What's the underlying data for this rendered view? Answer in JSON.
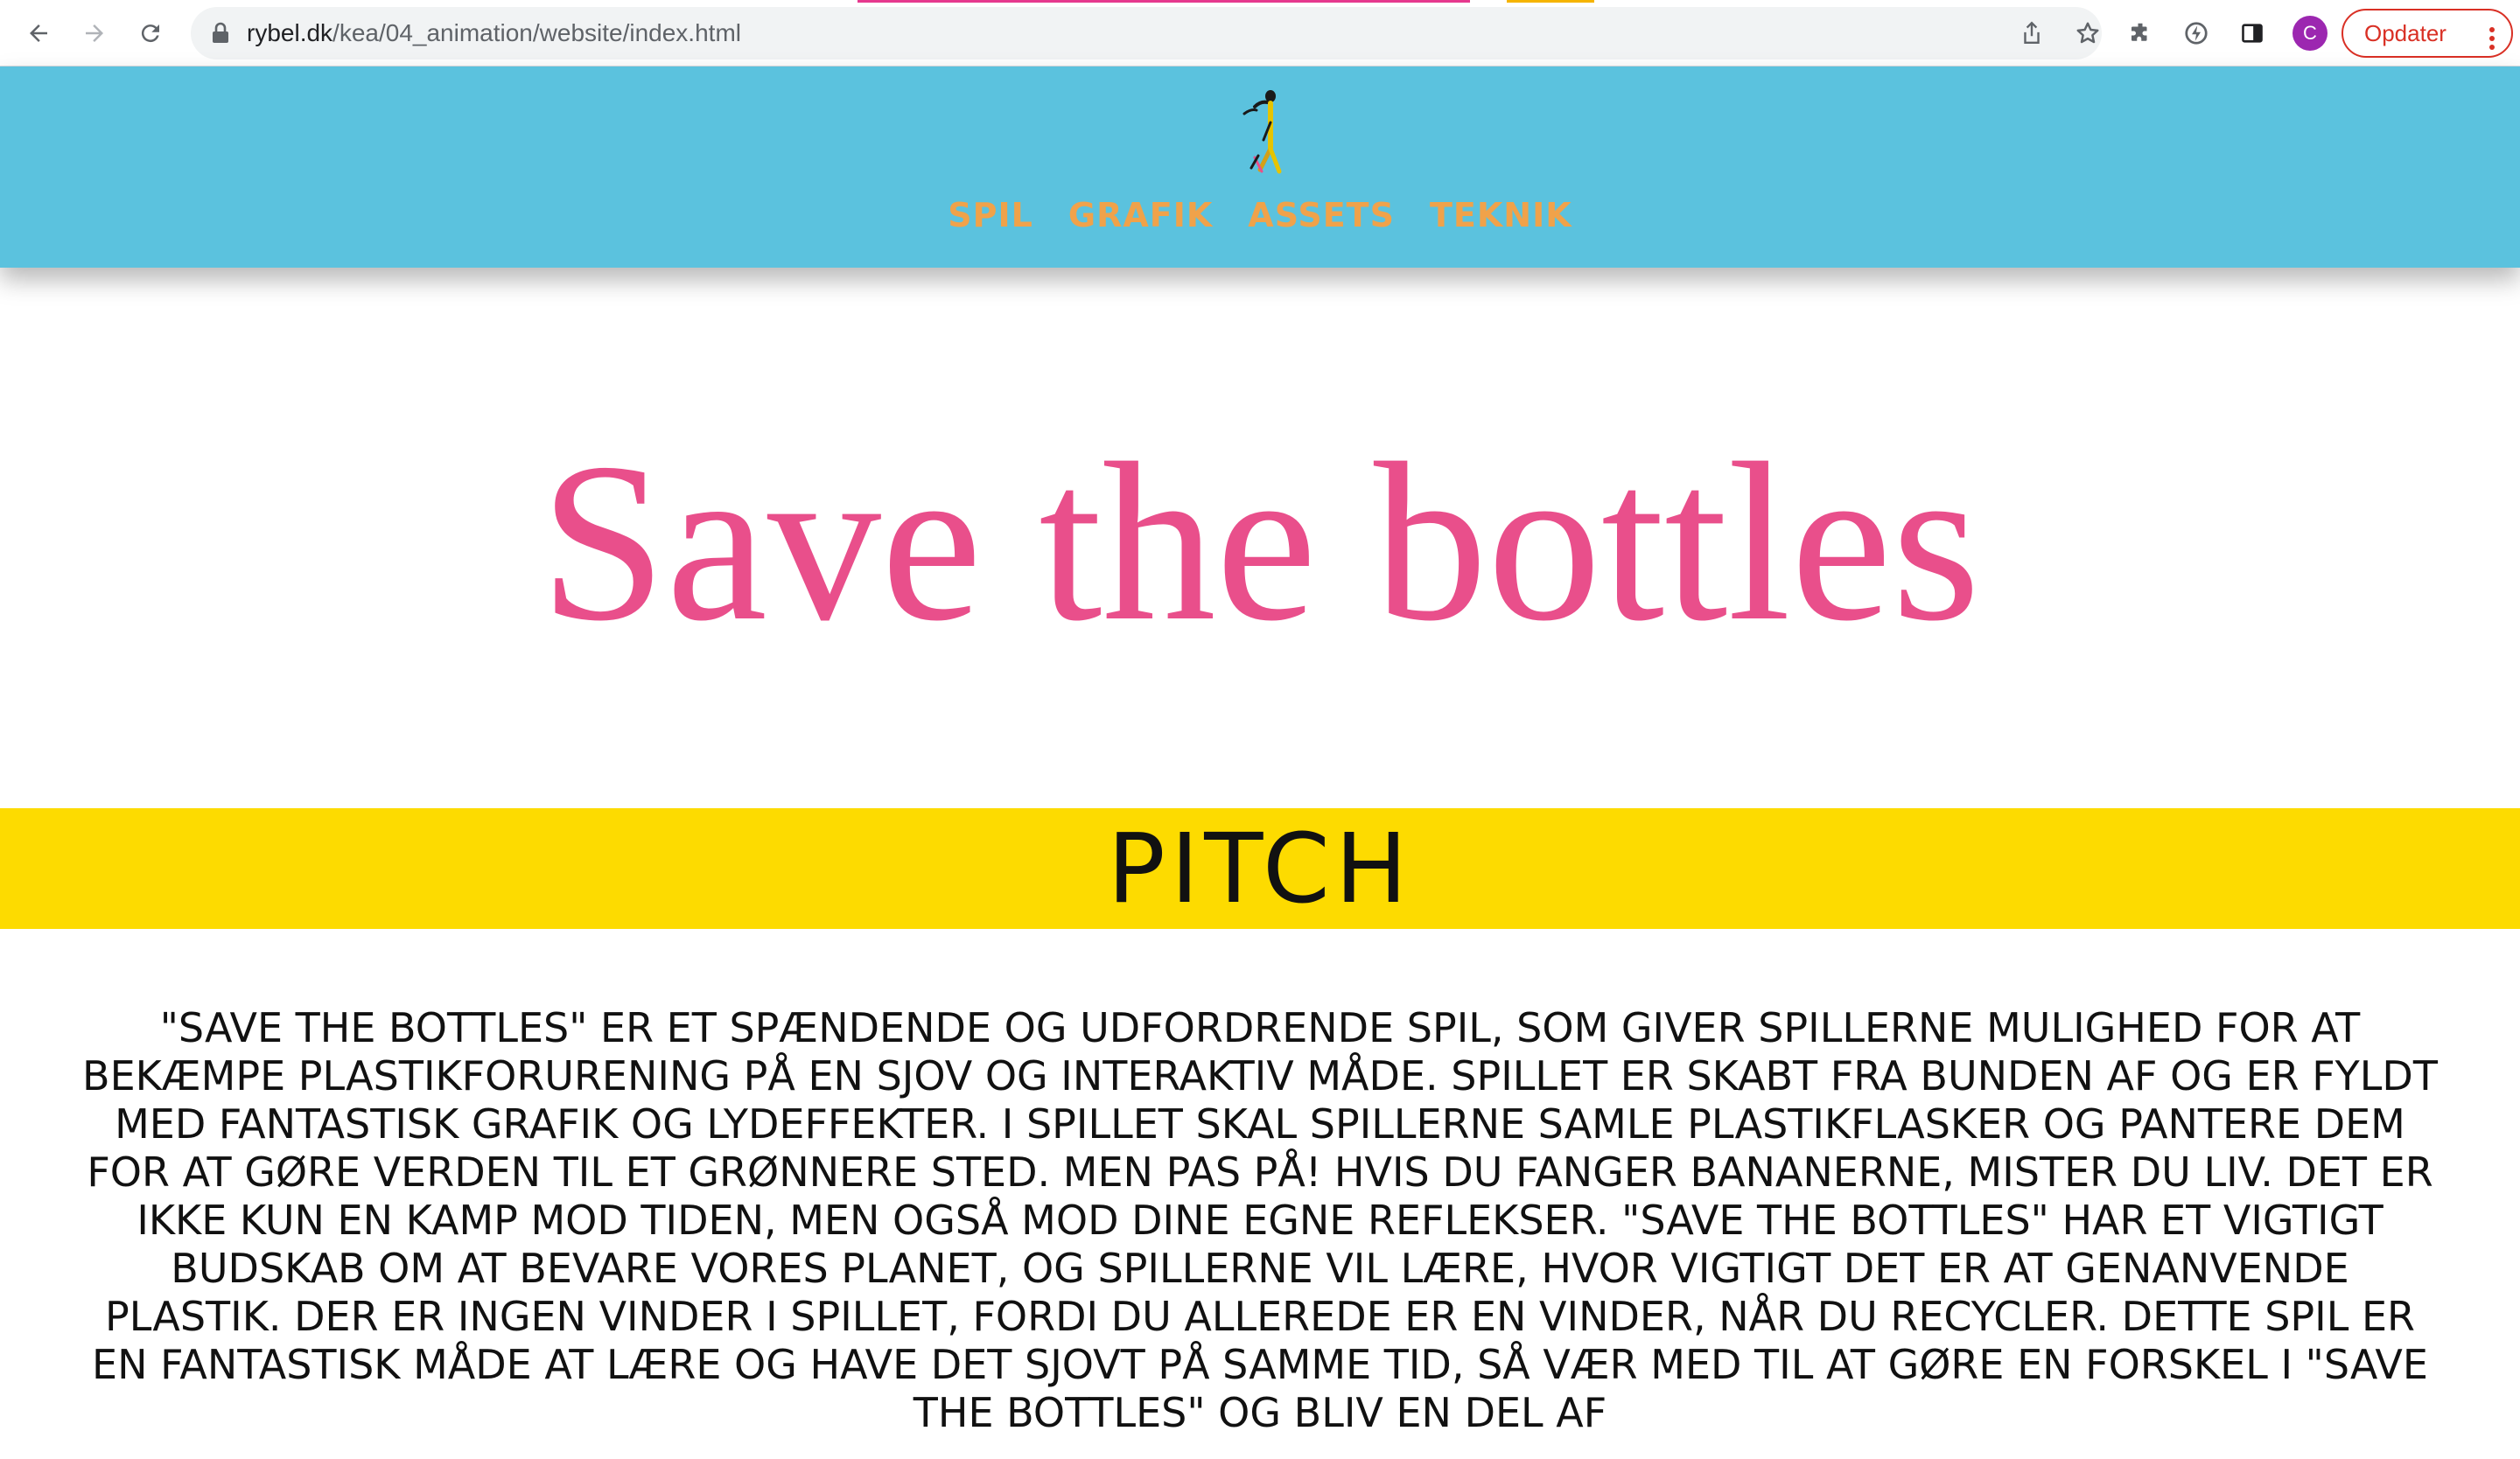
{
  "browser": {
    "url_host": "rybel.dk",
    "url_path": "/kea/04_animation/website/index.html",
    "avatar_letter": "C",
    "update_label": "Opdater",
    "icons": [
      "back-icon",
      "forward-icon",
      "reload-icon",
      "lock-icon",
      "share-icon",
      "star-icon",
      "extensions-icon",
      "performance-icon",
      "side-panel-icon",
      "more-icon"
    ]
  },
  "site": {
    "nav": [
      "SPIL",
      "GRAFIK",
      "ASSETS",
      "TEKNIK"
    ],
    "hero_title": "Save the bottles",
    "pitch_heading": "PITCH",
    "pitch_text": "\"Save the Bottles\" er et spændende og udfordrende spil, som giver spillerne mulighed for at bekæmpe plastikforurening på en sjov og interaktiv måde. Spillet er skabt fra bunden af og er fyldt med fantastisk grafik og lydeffekter. I spillet skal spillerne samle plastikflasker og pantere dem for at gøre verden til et grønnere sted. Men pas på! Hvis du fanger bananerne, mister du liv. Det er ikke kun en kamp mod tiden, men også mod dine egne reflekser. \"Save the Bottles\" har et vigtigt budskab om at bevare vores planet, og spillerne vil lære, hvor vigtigt det er at genanvende plastik. Der er ingen vinder i spillet, fordi du allerede er en vinder, når du recycler. Dette spil er en fantastisk måde at lære og have det sjovt på samme tid, så vær med til at gøre en forskel i \"Save the Bottles\" og bliv en del af"
  },
  "colors": {
    "header_bg": "#5bc2de",
    "nav_text": "#f0a24a",
    "title": "#e94f8b",
    "pitch_band": "#fddb00",
    "update": "#d93025",
    "avatar": "#9c27b0"
  }
}
